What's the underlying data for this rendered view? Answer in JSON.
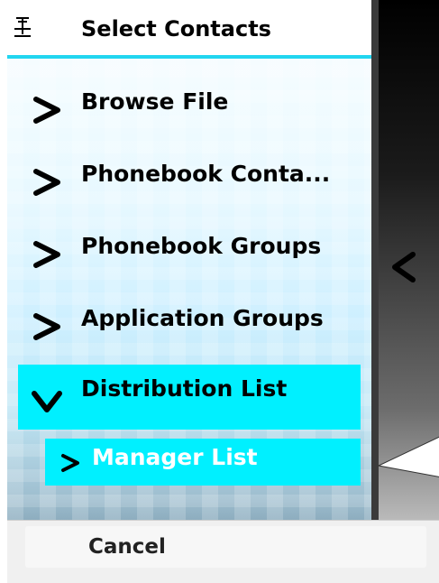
{
  "header": {
    "title": "Select Contacts",
    "icon": "sim-tool-icon"
  },
  "menu": {
    "items": [
      {
        "label": "Browse File"
      },
      {
        "label": "Phonebook Conta..."
      },
      {
        "label": "Phonebook Groups"
      },
      {
        "label": "Application Groups"
      },
      {
        "label": "Distribution List"
      }
    ],
    "subitems": [
      {
        "label": "Manager List"
      }
    ]
  },
  "softkeys": {
    "cancel_label": "Cancel"
  },
  "colors": {
    "highlight": "#00f0ff",
    "header_rule": "#22d6f0"
  }
}
